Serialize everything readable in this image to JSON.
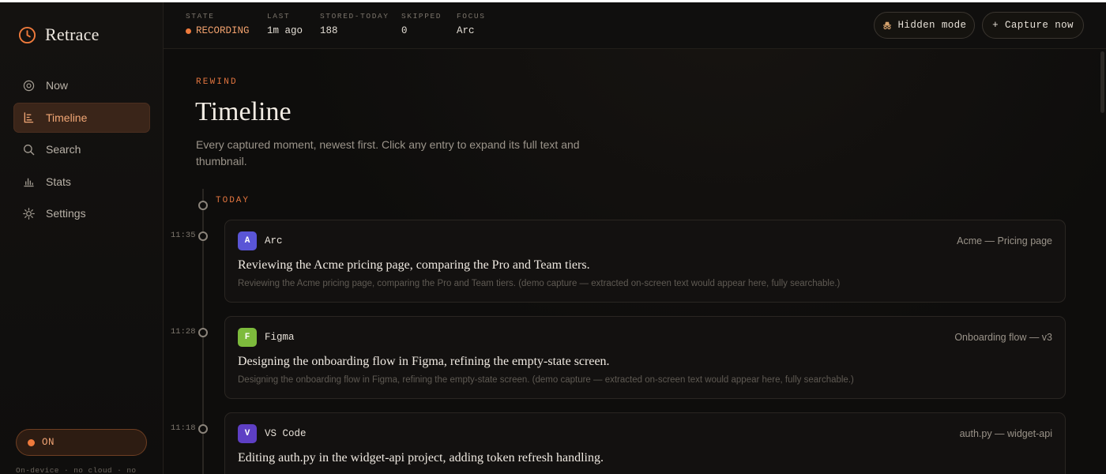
{
  "brand": {
    "name": "Retrace"
  },
  "nav": {
    "items": [
      {
        "label": "Now",
        "icon": "radio-icon",
        "active": false
      },
      {
        "label": "Timeline",
        "icon": "timeline-icon",
        "active": true
      },
      {
        "label": "Search",
        "icon": "search-icon",
        "active": false
      },
      {
        "label": "Stats",
        "icon": "bar-chart-icon",
        "active": false
      },
      {
        "label": "Settings",
        "icon": "gear-icon",
        "active": false
      }
    ]
  },
  "sidebar_footer": {
    "toggle_label": "ON",
    "note": "On-device · no cloud · no"
  },
  "status": {
    "state": {
      "label": "STATE",
      "value": "RECORDING"
    },
    "last": {
      "label": "LAST",
      "value": "1m ago"
    },
    "stored_today": {
      "label": "STORED-TODAY",
      "value": "188"
    },
    "skipped": {
      "label": "SKIPPED",
      "value": "0"
    },
    "focus": {
      "label": "FOCUS",
      "value": "Arc"
    }
  },
  "actions": {
    "hidden_mode": "Hidden mode",
    "capture_now": "Capture now"
  },
  "page": {
    "eyebrow": "REWIND",
    "title": "Timeline",
    "description": "Every captured moment, newest first. Click any entry to expand its full text and thumbnail."
  },
  "timeline": {
    "day_label": "TODAY",
    "entries": [
      {
        "time": "11:35",
        "app_initial": "A",
        "app": "Arc",
        "badge_color": "#5a55d6",
        "window": "Acme — Pricing page",
        "summary": "Reviewing the Acme pricing page, comparing the Pro and Team tiers.",
        "text": "Reviewing the Acme pricing page, comparing the Pro and Team tiers. (demo capture — extracted on-screen text would appear here, fully searchable.)"
      },
      {
        "time": "11:28",
        "app_initial": "F",
        "app": "Figma",
        "badge_color": "#7dbb3c",
        "window": "Onboarding flow — v3",
        "summary": "Designing the onboarding flow in Figma, refining the empty-state screen.",
        "text": "Designing the onboarding flow in Figma, refining the empty-state screen. (demo capture — extracted on-screen text would appear here, fully searchable.)"
      },
      {
        "time": "11:18",
        "app_initial": "V",
        "app": "VS Code",
        "badge_color": "#5e3fc4",
        "window": "auth.py — widget-api",
        "summary": "Editing auth.py in the widget-api project, adding token refresh handling.",
        "text": ""
      }
    ]
  },
  "colors": {
    "accent": "#ee7a3c",
    "background": "#0d0c0b"
  }
}
